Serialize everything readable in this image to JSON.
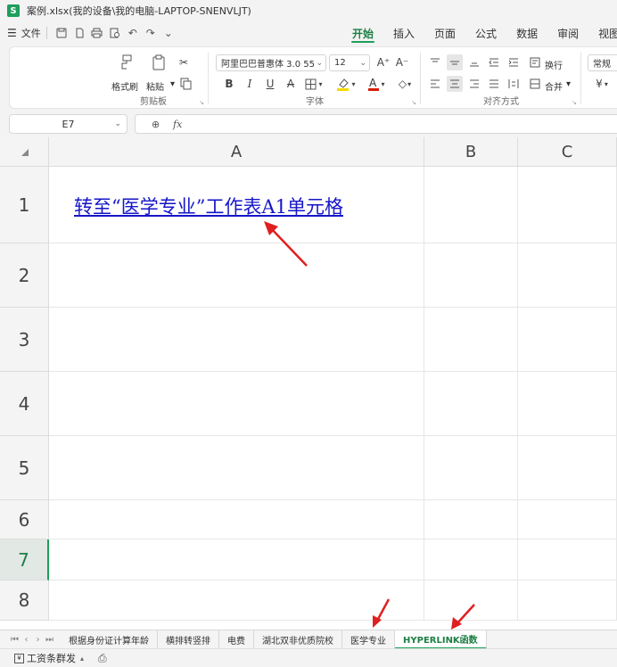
{
  "window": {
    "title": "案例.xlsx(我的设备\\我的电脑-LAPTOP-SNENVLJT)",
    "app_badge": "S"
  },
  "menu": {
    "file_label": "文件",
    "tabs": [
      "开始",
      "插入",
      "页面",
      "公式",
      "数据",
      "审阅",
      "视图"
    ],
    "active_tab": "开始"
  },
  "ribbon": {
    "clipboard": {
      "label": "剪贴板",
      "format_painter": "格式刷",
      "paste": "粘贴"
    },
    "font": {
      "label": "字体",
      "font_name": "阿里巴巴普惠体 3.0 55",
      "font_size": "12"
    },
    "alignment": {
      "label": "对齐方式",
      "wrap": "换行",
      "merge": "合并"
    },
    "number": {
      "format": "常规"
    },
    "colors": {
      "accent": "#1e9e5a",
      "fill_swatch": "#f5d800",
      "font_swatch": "#d81e06"
    }
  },
  "formula_bar": {
    "cell_ref": "E7",
    "fx": "fx",
    "value": ""
  },
  "grid": {
    "columns": [
      "A",
      "B",
      "C"
    ],
    "rows": [
      "1",
      "2",
      "3",
      "4",
      "5",
      "6",
      "7",
      "8"
    ],
    "selected_row": "7",
    "cells": {
      "A1": "转至“医学专业”工作表A1单元格"
    }
  },
  "sheets": {
    "tabs": [
      "根据身份证计算年龄",
      "横排转竖排",
      "电费",
      "湖北双非优质院校",
      "医学专业",
      "HYPERLINK函数"
    ],
    "active": "HYPERLINK函数"
  },
  "status": {
    "payroll_label": "工资条群发"
  }
}
